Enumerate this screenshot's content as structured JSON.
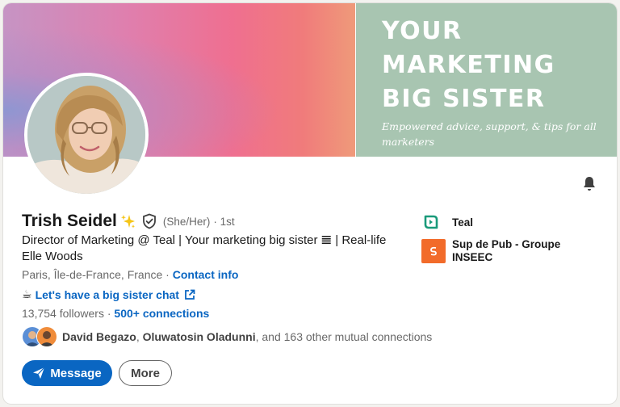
{
  "banner": {
    "headline_line1": "YOUR",
    "headline_line2": "MARKETING",
    "headline_line3": "BIG SISTER",
    "subtitle": "Empowered advice, support, & tips for all marketers"
  },
  "profile": {
    "name": "Trish Seidel",
    "pronouns": "(She/Her)",
    "degree": "· 1st",
    "headline": "Director of Marketing @ Teal | Your marketing big sister 𝌆 | Real-life Elle Woods",
    "location": "Paris, Île-de-France, France",
    "location_separator": " · ",
    "contact_info": "Contact info",
    "chat_emoji": "☕",
    "chat_link": "Let's have a big sister chat",
    "followers": "13,754 followers",
    "followers_separator": " · ",
    "connections": "500+ connections",
    "mutual_name1": "David Begazo",
    "mutual_sep": ", ",
    "mutual_name2": "Oluwatosin Oladunni",
    "mutual_rest": ", and 163 other mutual connections"
  },
  "actions": {
    "message_label": "Message",
    "more_label": "More"
  },
  "companies": [
    {
      "name": "Teal",
      "icon": "teal-logo-icon"
    },
    {
      "name": "Sup de Pub - Groupe INSEEC",
      "icon": "sup-de-pub-logo-icon"
    }
  ],
  "colors": {
    "accent": "#0a66c2",
    "banner_right": "#a8c5b1",
    "teal_brand": "#1a9a7a",
    "sup_brand": "#f26b2a"
  }
}
